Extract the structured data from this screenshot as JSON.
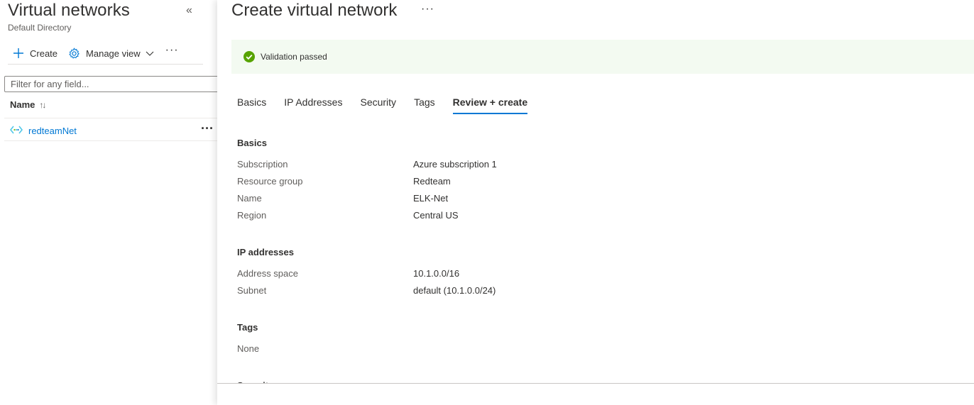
{
  "left_panel": {
    "title": "Virtual networks",
    "subtitle": "Default Directory",
    "collapse_icon": "double-chevron-left-icon",
    "toolbar": {
      "create_label": "Create",
      "manage_view_label": "Manage view",
      "more_label": "···"
    },
    "filter": {
      "placeholder": "Filter for any field...",
      "value": ""
    },
    "table": {
      "column_name": "Name",
      "sort_glyph": "↑↓",
      "rows": [
        {
          "name": "redteamNet",
          "more": "···"
        }
      ]
    }
  },
  "right_panel": {
    "title": "Create virtual network",
    "more_label": "···",
    "validation": {
      "text": "Validation passed",
      "status_color": "#57a300"
    },
    "tabs": [
      {
        "label": "Basics",
        "active": false
      },
      {
        "label": "IP Addresses",
        "active": false
      },
      {
        "label": "Security",
        "active": false
      },
      {
        "label": "Tags",
        "active": false
      },
      {
        "label": "Review + create",
        "active": true
      }
    ],
    "sections": {
      "basics": {
        "title": "Basics",
        "items": [
          {
            "label": "Subscription",
            "value": "Azure subscription 1"
          },
          {
            "label": "Resource group",
            "value": "Redteam"
          },
          {
            "label": "Name",
            "value": "ELK-Net"
          },
          {
            "label": "Region",
            "value": "Central US"
          }
        ]
      },
      "ip_addresses": {
        "title": "IP addresses",
        "items": [
          {
            "label": "Address space",
            "value": "10.1.0.0/16"
          },
          {
            "label": "Subnet",
            "value": "default (10.1.0.0/24)"
          }
        ]
      },
      "tags": {
        "title": "Tags",
        "items": [
          {
            "label": "None",
            "value": ""
          }
        ]
      },
      "security": {
        "title": "Security"
      }
    }
  },
  "colors": {
    "accent": "#0078d4",
    "banner_bg": "#f3faf1",
    "success": "#57a300"
  }
}
